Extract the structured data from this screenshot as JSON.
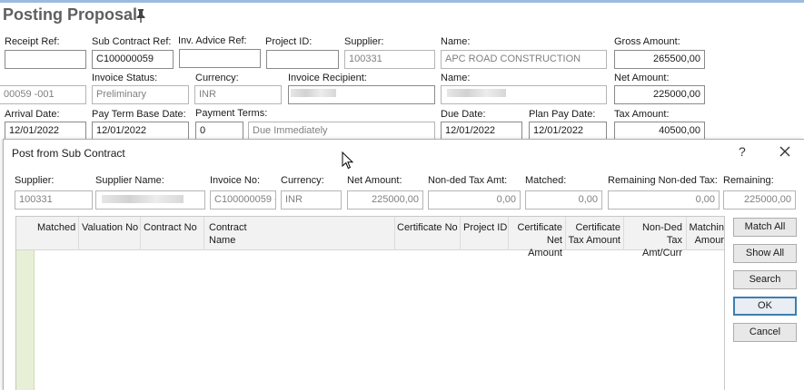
{
  "page": {
    "title": "Posting Proposal"
  },
  "posting": {
    "receipt_ref": {
      "label": "Receipt Ref:",
      "value": ""
    },
    "sub_contract_ref": {
      "label": "Sub Contract Ref:",
      "value": "C100000059"
    },
    "inv_advice_ref": {
      "label": "Inv. Advice Ref:",
      "value": ""
    },
    "project_id": {
      "label": "Project ID:",
      "value": ""
    },
    "supplier": {
      "label": "Supplier:",
      "value": "100331"
    },
    "name1": {
      "label": "Name:",
      "value": "APC ROAD CONSTRUCTION"
    },
    "gross_amount": {
      "label": "Gross Amount:",
      "value": "265500,00"
    },
    "ref_partial": {
      "value": "00059 -001"
    },
    "invoice_status": {
      "label": "Invoice Status:",
      "value": "Preliminary"
    },
    "currency": {
      "label": "Currency:",
      "value": "INR"
    },
    "invoice_recipient": {
      "label": "Invoice Recipient:",
      "value": ""
    },
    "name2": {
      "label": "Name:",
      "value": ""
    },
    "net_amount": {
      "label": "Net Amount:",
      "value": "225000,00"
    },
    "arrival_date": {
      "label": "Arrival Date:",
      "value": "12/01/2022"
    },
    "pay_term_base_date": {
      "label": "Pay Term Base Date:",
      "value": "12/01/2022"
    },
    "payment_terms": {
      "label": "Payment Terms:",
      "code": "0",
      "description": "Due Immediately"
    },
    "due_date": {
      "label": "Due Date:",
      "value": "12/01/2022"
    },
    "plan_pay_date": {
      "label": "Plan Pay Date:",
      "value": "12/01/2022"
    },
    "tax_amount": {
      "label": "Tax Amount:",
      "value": "40500,00"
    }
  },
  "dialog": {
    "title": "Post from Sub Contract",
    "help_label": "?",
    "fields": {
      "supplier": {
        "label": "Supplier:",
        "value": "100331"
      },
      "supplier_name": {
        "label": "Supplier Name:",
        "value": ""
      },
      "invoice_no": {
        "label": "Invoice No:",
        "value": "C100000059 -"
      },
      "currency": {
        "label": "Currency:",
        "value": "INR"
      },
      "net_amount": {
        "label": "Net Amount:",
        "value": "225000,00"
      },
      "non_ded_tax_amt": {
        "label": "Non-ded Tax Amt:",
        "value": "0,00"
      },
      "matched": {
        "label": "Matched:",
        "value": "0,00"
      },
      "remaining_non_ded_tax": {
        "label": "Remaining Non-ded Tax:",
        "value": "0,00"
      },
      "remaining": {
        "label": "Remaining:",
        "value": "225000,00"
      }
    },
    "grid": {
      "columns": {
        "matched": "Matched",
        "valuation_no": "Valuation No",
        "contract_no": "Contract No",
        "contract_name_1": "Contract",
        "contract_name_2": "Name",
        "certificate_no": "Certificate No",
        "project_id": "Project ID",
        "cert_net_1": "Certificate",
        "cert_net_2": "Net Amount",
        "cert_tax_1": "Certificate",
        "cert_tax_2": "Tax Amount",
        "non_ded_1": "Non-Ded",
        "non_ded_2": "Tax Amt/Curr",
        "matching_1": "Matchin",
        "matching_2": "Amour"
      }
    },
    "buttons": {
      "match_all": "Match All",
      "show_all": "Show All",
      "search": "Search",
      "ok": "OK",
      "cancel": "Cancel"
    }
  },
  "icons": {
    "pin": "pin-icon",
    "close": "close-icon",
    "cursor": "mouse-cursor-icon"
  }
}
